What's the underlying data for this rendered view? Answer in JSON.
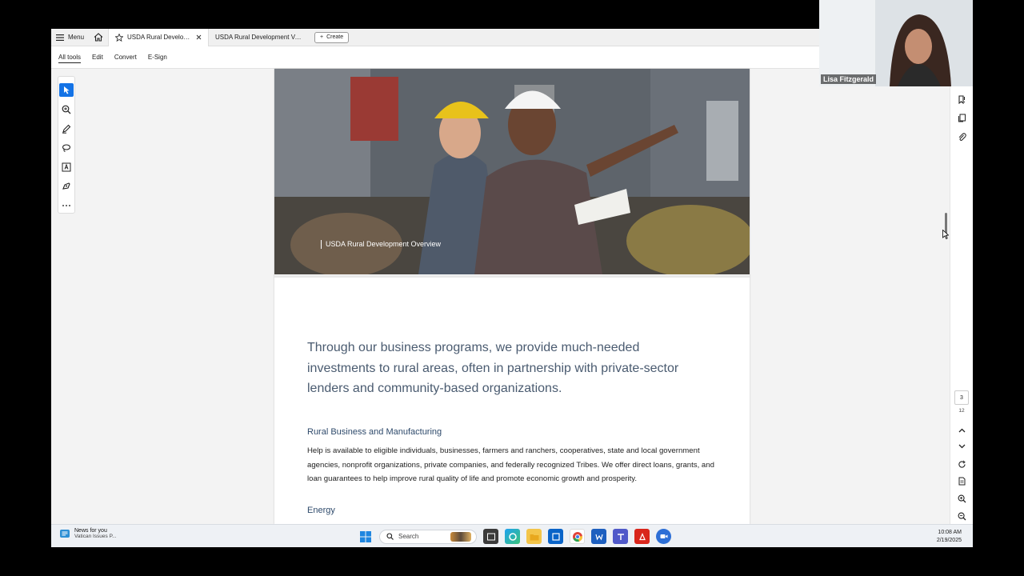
{
  "tabbar": {
    "menu_label": "Menu",
    "tabs": [
      {
        "title": "USDA Rural Developme..",
        "active": true
      },
      {
        "title": "USDA Rural Development Value..",
        "active": false
      }
    ],
    "create_label": "Create"
  },
  "menubar": {
    "items": [
      "All tools",
      "Edit",
      "Convert",
      "E-Sign"
    ]
  },
  "document": {
    "hero_caption": "USDA Rural Development Overview",
    "lead": "Through our business programs, we provide much-needed investments to rural areas, often in partnership with private-sector lenders and community-based organizations.",
    "section1_title": "Rural Business and Manufacturing",
    "section1_body": "Help is available to eligible individuals, businesses, farmers and ranchers, cooperatives, state and local government agencies, nonprofit organizations, private companies, and federally recognized Tribes. We offer direct loans, grants, and loan guarantees to help improve rural quality of life and promote economic growth and prosperity.",
    "section2_title": "Energy"
  },
  "pagination": {
    "current": "3",
    "total": "12"
  },
  "taskbar": {
    "news_title": "News for you",
    "news_sub": "Vatican Issues P...",
    "search_placeholder": "Search",
    "time": "10:08 AM",
    "date": "2/19/2025"
  },
  "video": {
    "participant_name": "Lisa Fitzgerald"
  },
  "colors": {
    "accent": "#1473e6",
    "heading": "#4a5b70",
    "subheading": "#2e4a6b"
  }
}
